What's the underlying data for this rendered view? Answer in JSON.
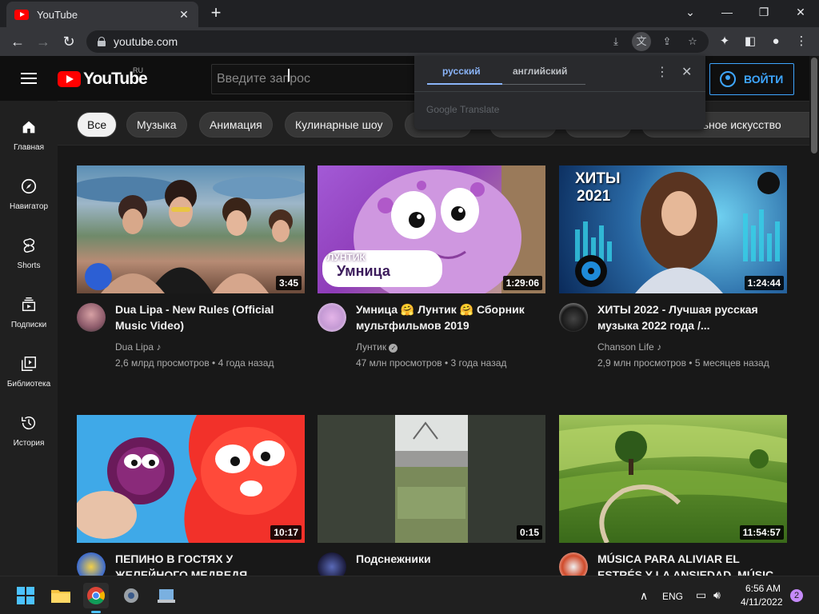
{
  "browser": {
    "tab_title": "YouTube",
    "url": "youtube.com"
  },
  "youtube": {
    "region": "RU",
    "logo_text": "YouTube",
    "search_placeholder": "Введите запрос",
    "signin_label": "ВОЙТИ"
  },
  "translate": {
    "lang_source": "русский",
    "lang_target": "английский",
    "brand": "Google Translate"
  },
  "chips": [
    "Все",
    "Музыка",
    "Анимация",
    "Кулинарные шоу",
    "",
    "",
    "",
    "тельное искусство"
  ],
  "sidebar": [
    {
      "label": "Главная"
    },
    {
      "label": "Навигатор"
    },
    {
      "label": "Shorts"
    },
    {
      "label": "Подписки"
    },
    {
      "label": "Библиотека"
    },
    {
      "label": "История"
    }
  ],
  "videos": [
    {
      "title": "Dua Lipa - New Rules (Official Music Video)",
      "channel": "Dua Lipa",
      "meta": "2,6 млрд просмотров • 4 года назад",
      "duration": "3:45"
    },
    {
      "title": "Умница 🤗 Лунтик 🤗 Сборник мультфильмов 2019",
      "channel": "Лунтик",
      "meta": "47 млн просмотров • 3 года назад",
      "duration": "1:29:06",
      "thumb_text_1": "ЛУНТИК",
      "thumb_text_2": "Умница"
    },
    {
      "title": "ХИТЫ 2022 - Лучшая русская музыка 2022 года /...",
      "channel": "Chanson Life",
      "meta": "2,9 млн просмотров • 5 месяцев назад",
      "duration": "1:24:44",
      "thumb_text_1": "ХИТЫ",
      "thumb_text_2": "2021"
    },
    {
      "title": "ПЕПИНО В ГОСТЯХ У ЖЕЛЕЙНОГО МЕДВЕДЯ",
      "channel": "",
      "meta": "",
      "duration": "10:17"
    },
    {
      "title": "Подснежники",
      "channel": "",
      "meta": "",
      "duration": "0:15"
    },
    {
      "title": "MÚSICA PARA ALIVIAR EL ESTRÉS Y LA ANSIEDAD, MÚSIC...",
      "channel": "",
      "meta": "",
      "duration": "11:54:57"
    }
  ],
  "taskbar": {
    "lang": "ENG",
    "time": "6:56 AM",
    "date": "4/11/2022",
    "notifications": "2"
  },
  "colors": {
    "accent_blue": "#3ea6ff",
    "youtube_red": "#ff0000",
    "translate_blue": "#8ab4f8"
  }
}
